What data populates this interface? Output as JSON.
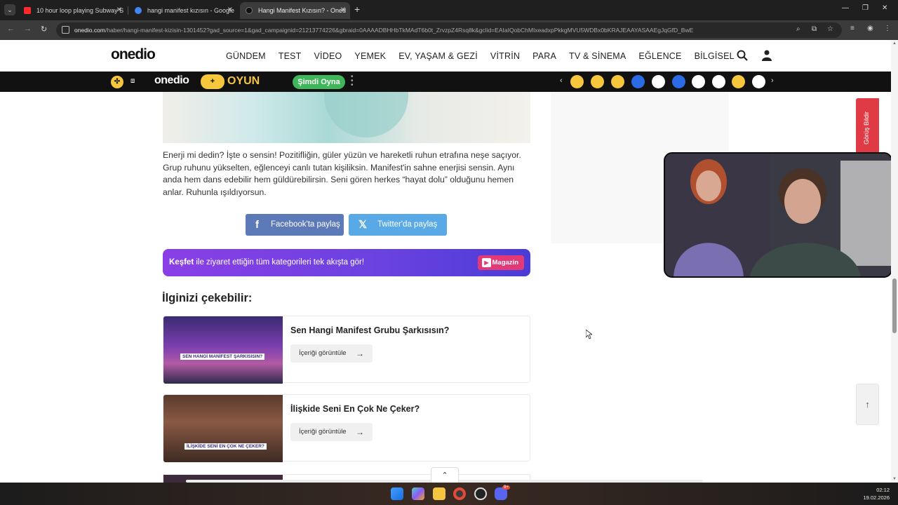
{
  "browser": {
    "tabs": [
      {
        "title": "10 hour loop playing Subway S",
        "color": "#ff2a2a"
      },
      {
        "title": "hangi manifest kızısın - Google",
        "color": "#4285f4"
      },
      {
        "title": "Hangi Manifest Kızısın? - Oned",
        "color": "#111111"
      }
    ],
    "url_domain": "onedio.com",
    "url_path": "/haber/hangi-manifest-kizisin-1301452?gad_source=1&gad_campaignid=21213774226&gbraid=0AAAADBHHbTkMAdT6b0t_ZrvzpZ4Rsq8k&gclid=EAIaIQobChMIxeadxpPkkgMVU5WDBx0bKRAJEAAYASAAEgJqGfD_BwE"
  },
  "site": {
    "logo": "onedio",
    "nav": [
      "GÜNDEM",
      "TEST",
      "VİDEO",
      "YEMEK",
      "EV, YAŞAM & GEZİ",
      "VİTRİN",
      "PARA",
      "TV & SİNEMA",
      "EĞLENCE",
      "BİLGİSEL"
    ]
  },
  "gamebar": {
    "logo": "onedio",
    "plus": "+",
    "oyun": "OYUN",
    "play_label": "Şimdi Oyna",
    "emoji_colors": [
      "#f6c63d",
      "#f6c63d",
      "#f6c63d",
      "#2b6be6",
      "#ffffff",
      "#2b6be6",
      "#ffffff",
      "#ffffff",
      "#f6c63d",
      "#ffffff"
    ]
  },
  "article": {
    "paragraph": "Enerji mi dedin? İşte o sensin! Pozitifliğin, güler yüzün ve hareketli ruhun etrafına neşe saçıyor. Grup ruhunu yükselten, eğlenceyi canlı tutan kişiliksin. Manifest'in sahne enerjisi sensin. Aynı anda hem dans edebilir hem güldürebilirsin. Seni gören herkes “hayat dolu” olduğunu hemen anlar. Ruhunla ışıldıyorsun.",
    "share_facebook": "Facebook'ta paylaş",
    "share_twitter": "Twitter'da paylaş",
    "kesfet_bold": "Keşfet",
    "kesfet_rest": " ile ziyaret ettiğin tüm kategorileri tek akışta gör!",
    "kesfet_tag": "Magazin",
    "related_title": "İlginizi çekebilir:",
    "related": [
      {
        "title": "Sen Hangi Manifest Grubu Şarkısısın?",
        "button": "İçeriği görüntüle",
        "caption": "SEN HANGİ MANİFEST ŞARKISISIN?"
      },
      {
        "title": "İlişkide Seni En Çok Ne Çeker?",
        "button": "İçeriği görüntüle",
        "caption": "İLİŞKİDE SENİ EN ÇOK NE ÇEKER?"
      }
    ]
  },
  "sidebar": {
    "feedback": "Görüş Bildir"
  },
  "taskbar": {
    "time": "02:12",
    "date": "19.02.2026",
    "badge": "9+"
  }
}
